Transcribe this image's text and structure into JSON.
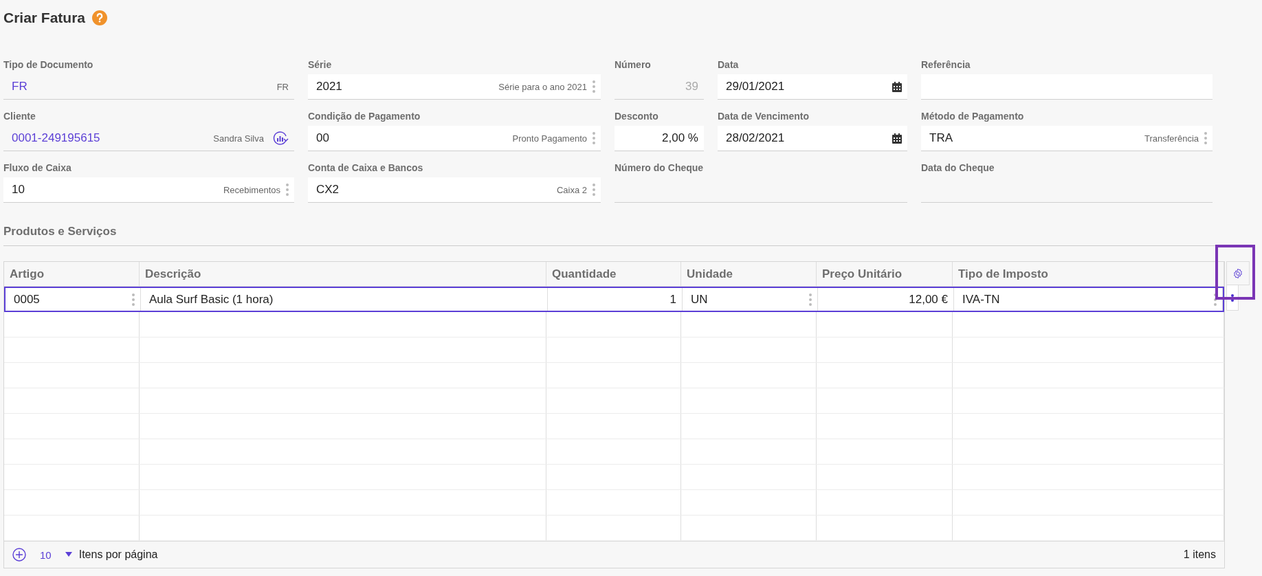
{
  "title": "Criar Fatura",
  "form_rows": [
    [
      {
        "label": "Tipo de Documento",
        "kind": "reference",
        "value": "FR",
        "description": "FR"
      },
      {
        "label": "Série",
        "kind": "lookup",
        "value": "2021",
        "description": "Série para o ano 2021"
      },
      {
        "label": "Número",
        "kind": "readonly",
        "value": "39"
      },
      {
        "label": "Data",
        "kind": "date",
        "value": "29/01/2021"
      },
      {
        "label": "Referência",
        "kind": "text"
      }
    ],
    [
      {
        "label": "Cliente",
        "kind": "reference_refresh",
        "value": "0001-249195615",
        "description": "Sandra Silva"
      },
      {
        "label": "Condição de Pagamento",
        "kind": "lookup",
        "value": "00",
        "description": "Pronto Pagamento"
      },
      {
        "label": "Desconto",
        "kind": "numeric",
        "value": "2,00 %"
      },
      {
        "label": "Data de Vencimento",
        "kind": "date",
        "value": "28/02/2021"
      },
      {
        "label": "Método de Pagamento",
        "kind": "lookup",
        "value": "TRA",
        "description": "Transferência"
      }
    ],
    [
      {
        "label": "Fluxo de Caixa",
        "kind": "lookup",
        "value": "10",
        "description": "Recebimentos"
      },
      {
        "label": "Conta de Caixa e Bancos",
        "kind": "lookup",
        "value": "CX2",
        "description": "Caixa 2"
      },
      {
        "label": "Número do Cheque",
        "kind": "blank"
      },
      {
        "label": "Data do Cheque",
        "kind": "blank"
      }
    ]
  ],
  "section_title": "Produtos e Serviços",
  "table": {
    "columns": [
      {
        "label": "Artigo",
        "kind": "lookup"
      },
      {
        "label": "Descrição",
        "kind": "text"
      },
      {
        "label": "Quantidade",
        "kind": "number"
      },
      {
        "label": "Unidade",
        "kind": "lookup"
      },
      {
        "label": "Preço Unitário",
        "kind": "number"
      },
      {
        "label": "Tipo de Imposto",
        "kind": "lookup"
      }
    ],
    "rows": [
      {
        "selected": true,
        "cells": [
          "0005",
          "Aula Surf Basic (1 hora)",
          "1",
          "UN",
          "12,00 €",
          "IVA-TN"
        ]
      }
    ]
  },
  "pager": {
    "page_size": "10",
    "label": "Itens por página",
    "count": "1 itens"
  }
}
